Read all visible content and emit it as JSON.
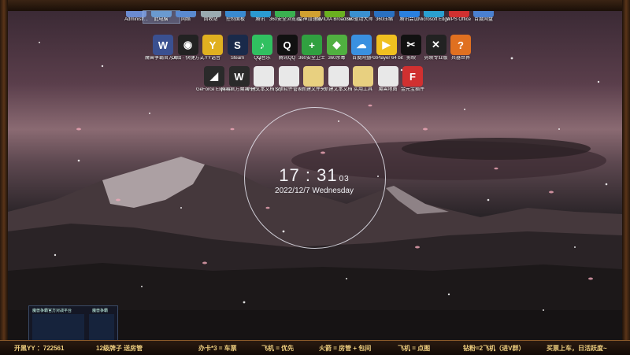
{
  "top_icons": [
    {
      "label": "Administr...",
      "color": "#6b8bd0"
    },
    {
      "label": "此电脑",
      "color": "#6a9ad0"
    },
    {
      "label": "网络",
      "color": "#5a8ad0"
    },
    {
      "label": "回收站",
      "color": "#9aaab0"
    },
    {
      "label": "控制面板",
      "color": "#3a8ad0"
    },
    {
      "label": "腾讯",
      "color": "#2a9ad0"
    },
    {
      "label": "360安全浏览器",
      "color": "#3ab050"
    },
    {
      "label": "雷神加速器",
      "color": "#d0a030"
    },
    {
      "label": "NVIDIA Broadcast",
      "color": "#6ab020"
    },
    {
      "label": "360驱动大师",
      "color": "#3a90d0"
    },
    {
      "label": "360压缩",
      "color": "#2a70c0"
    },
    {
      "label": "腾讯会议",
      "color": "#2a80e0"
    },
    {
      "label": "Microsoft Edge",
      "color": "#2aa0d0"
    },
    {
      "label": "WPS Office",
      "color": "#d03030"
    },
    {
      "label": "百度网盘",
      "color": "#4a80d0"
    }
  ],
  "row2_icons": [
    {
      "label": "魔兽争霸官方对战平台",
      "color": "#3a5090",
      "glyph": "W"
    },
    {
      "label": "OBS · 快捷方式",
      "color": "#222",
      "glyph": "◉"
    },
    {
      "label": "YY语音",
      "color": "#e0b020",
      "glyph": "Y"
    },
    {
      "label": "Steam",
      "color": "#1a2a4a",
      "glyph": "S"
    },
    {
      "label": "QQ音乐",
      "color": "#30c060",
      "glyph": "♪"
    },
    {
      "label": "腾讯QQ",
      "color": "#111",
      "glyph": "Q"
    },
    {
      "label": "360安全卫士",
      "color": "#30a040",
      "glyph": "+"
    },
    {
      "label": "360杀毒",
      "color": "#50b040",
      "glyph": "◆"
    },
    {
      "label": "百度网盘",
      "color": "#3a90e0",
      "glyph": "☁"
    },
    {
      "label": "PotPlayer 64 bit",
      "color": "#f0c020",
      "glyph": "▶"
    },
    {
      "label": "剪映",
      "color": "#111",
      "glyph": "✂"
    },
    {
      "label": "剪映专业版",
      "color": "#222",
      "glyph": "✕"
    },
    {
      "label": "兵器世界",
      "color": "#e07020",
      "glyph": "?"
    }
  ],
  "row3_icons": [
    {
      "label": "GeForce Experience",
      "color": "#2a2a2a",
      "glyph": "◢"
    },
    {
      "label": "网易官方魔兽平台",
      "color": "#2a2a2a",
      "glyph": "W"
    },
    {
      "label": "新建文本文档 (2)",
      "color": "#e8e8e8",
      "glyph": ""
    },
    {
      "label": "Soft软件管家",
      "color": "#e8e8e8",
      "glyph": ""
    },
    {
      "label": "新建文件夹",
      "color": "#e8d080",
      "glyph": ""
    },
    {
      "label": "新建文本文档",
      "color": "#e8e8e8",
      "glyph": ""
    },
    {
      "label": "实用工具",
      "color": "#e8d080",
      "glyph": ""
    },
    {
      "label": "魔兽地图",
      "color": "#e8e8e8",
      "glyph": ""
    },
    {
      "label": "金元宝插件",
      "color": "#d03030",
      "glyph": "F"
    }
  ],
  "clock": {
    "hour": "17",
    "minute": "31",
    "second": "03",
    "date": "2022/12/7 Wednesday"
  },
  "thumbnail": {
    "win1": "魔兽争霸官方对战平台",
    "win2": "魔兽争霸"
  },
  "stream_bar": [
    {
      "text": "开黑YY ：722561"
    },
    {
      "text": "12级牌子 送房管"
    },
    {
      "text": "办卡*3 = 车票"
    },
    {
      "text": "飞机 = 优先"
    },
    {
      "text": "火箭 = 房管 + 包间"
    },
    {
      "text": "飞机 = 点图"
    },
    {
      "text": "钻粉=2飞机（进V群）"
    },
    {
      "text": "买票上车，日活跃度~"
    }
  ]
}
